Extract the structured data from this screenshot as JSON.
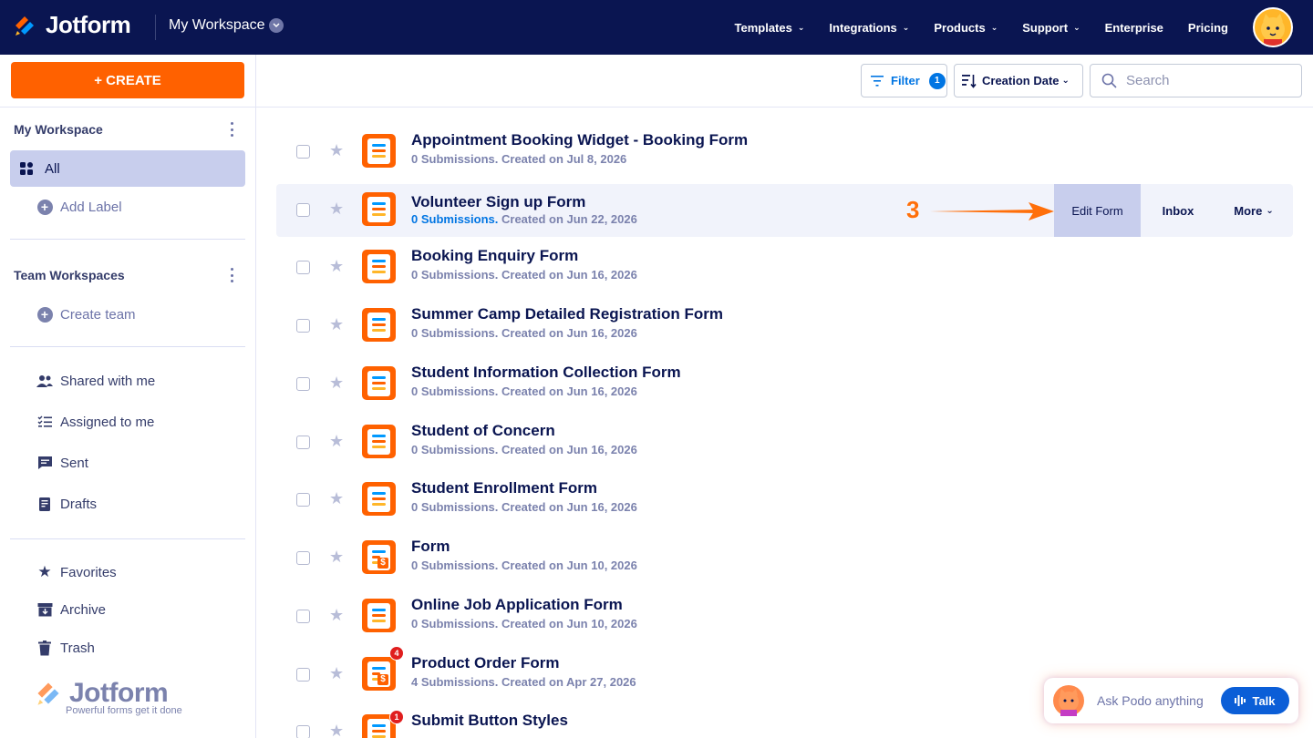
{
  "topbar": {
    "brand": "Jotform",
    "workspace_title": "My Workspace",
    "nav": [
      "Templates",
      "Integrations",
      "Products",
      "Support",
      "Enterprise",
      "Pricing"
    ]
  },
  "sidebar": {
    "create_label": "+ CREATE",
    "my_workspace_heading": "My Workspace",
    "all_label": "All",
    "add_label": "Add Label",
    "team_heading": "Team Workspaces",
    "create_team": "Create team",
    "items": {
      "shared": "Shared with me",
      "assigned": "Assigned to me",
      "sent": "Sent",
      "drafts": "Drafts",
      "favorites": "Favorites",
      "archive": "Archive",
      "trash": "Trash"
    },
    "footer_brand": "Jotform",
    "footer_tagline": "Powerful forms get it done"
  },
  "toolbar": {
    "filter_label": "Filter",
    "filter_count": "1",
    "sort_label": "Creation Date",
    "search_placeholder": "Search"
  },
  "forms": [
    {
      "title": "Appointment Booking Widget - Booking Form",
      "submissions": "0 Submissions.",
      "created": "Created on Jul 8, 2026"
    },
    {
      "title": "Volunteer Sign up Form",
      "submissions": "0 Submissions.",
      "created": "Created on Jun 22, 2026"
    },
    {
      "title": "Booking Enquiry Form",
      "submissions": "0 Submissions.",
      "created": "Created on Jun 16, 2026"
    },
    {
      "title": "Summer Camp Detailed Registration Form",
      "submissions": "0 Submissions.",
      "created": "Created on Jun 16, 2026"
    },
    {
      "title": "Student Information Collection Form",
      "submissions": "0 Submissions.",
      "created": "Created on Jun 16, 2026"
    },
    {
      "title": "Student of Concern",
      "submissions": "0 Submissions.",
      "created": "Created on Jun 16, 2026"
    },
    {
      "title": "Student Enrollment Form",
      "submissions": "0 Submissions.",
      "created": "Created on Jun 16, 2026"
    },
    {
      "title": "Form",
      "submissions": "0 Submissions.",
      "created": "Created on Jun 10, 2026"
    },
    {
      "title": "Online Job Application Form",
      "submissions": "0 Submissions.",
      "created": "Created on Jun 10, 2026"
    },
    {
      "title": "Product Order Form",
      "submissions": "4 Submissions.",
      "created": "Created on Apr 27, 2026",
      "badge": "4"
    },
    {
      "title": "Submit Button Styles",
      "submissions": "",
      "created": "",
      "badge": "1"
    }
  ],
  "row_actions": {
    "edit": "Edit Form",
    "inbox": "Inbox",
    "more": "More"
  },
  "annotation": "3",
  "podo": {
    "prompt": "Ask Podo anything",
    "talk": "Talk"
  },
  "colors": {
    "navy": "#0a1551",
    "orange": "#ff6100",
    "blue": "#0075e3",
    "highlight": "#c8ceed"
  }
}
